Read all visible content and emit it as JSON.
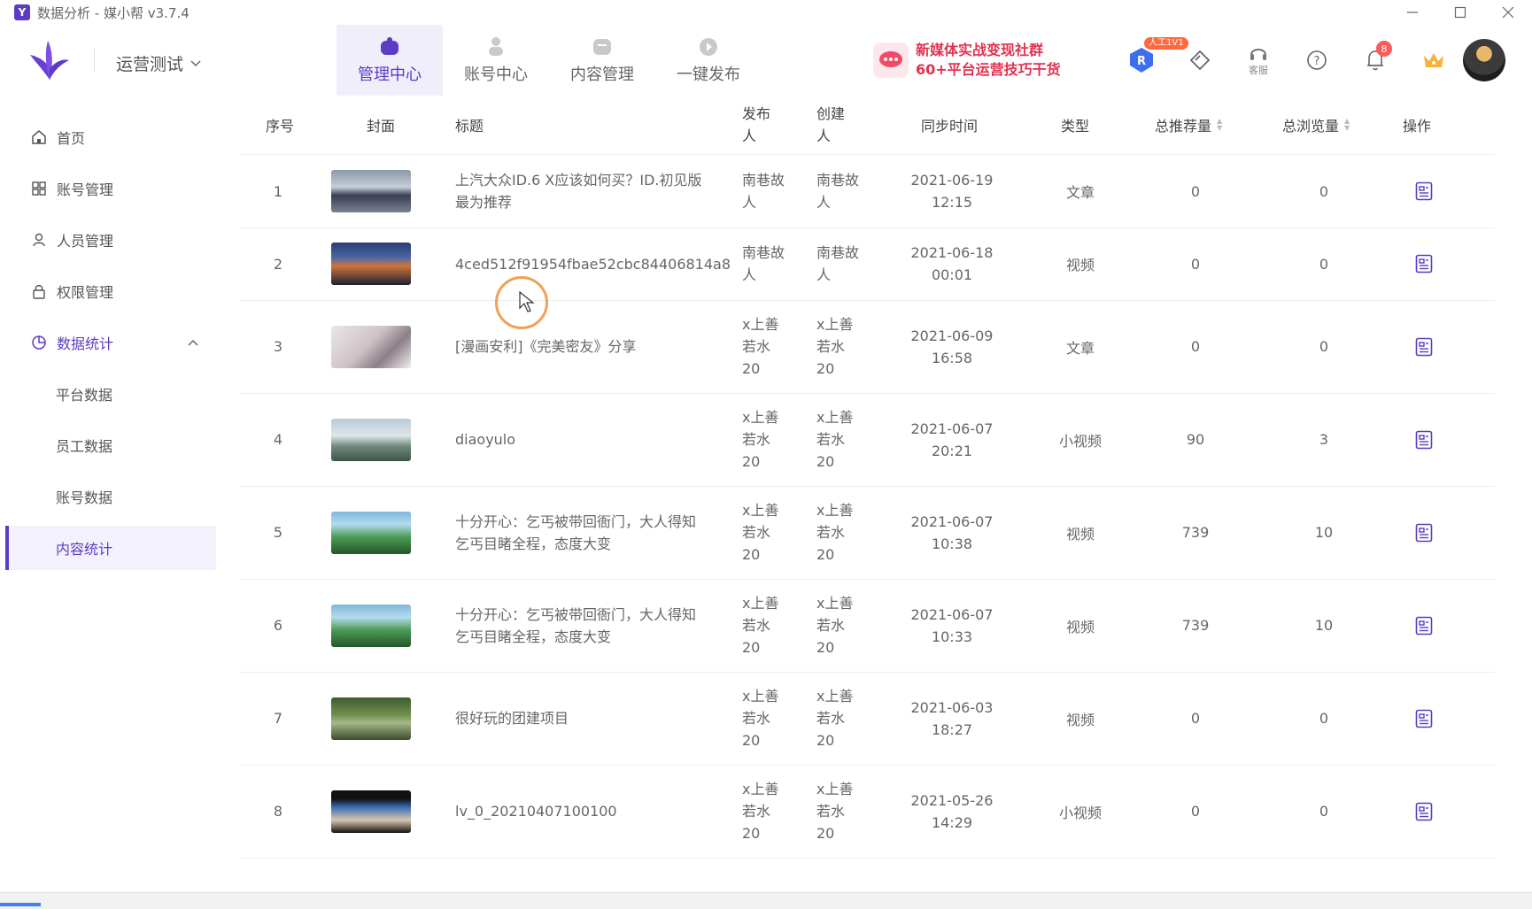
{
  "window": {
    "title": "数据分析 - 媒小帮 v3.7.4",
    "app_icon": "Y",
    "controls": [
      "minimize-icon",
      "maximize-icon",
      "close-icon"
    ]
  },
  "header": {
    "team_name": "运营测试",
    "nav": [
      {
        "label": "管理中心",
        "icon": "management-center-icon",
        "active": true
      },
      {
        "label": "账号中心",
        "icon": "account-center-icon",
        "active": false
      },
      {
        "label": "内容管理",
        "icon": "content-management-icon",
        "active": false
      },
      {
        "label": "一键发布",
        "icon": "publish-icon",
        "active": false
      }
    ],
    "banner": {
      "line1": "新媒体实战变现社群",
      "line2": "60+平台运营技巧干货"
    },
    "tag_label": "人工1V1",
    "service_label": "客服",
    "notification_count": "8",
    "accent_color": "#5b3cc4"
  },
  "sidebar": {
    "items": [
      {
        "label": "首页",
        "icon": "home-icon"
      },
      {
        "label": "账号管理",
        "icon": "grid-icon"
      },
      {
        "label": "人员管理",
        "icon": "user-icon"
      },
      {
        "label": "权限管理",
        "icon": "lock-icon"
      },
      {
        "label": "数据统计",
        "icon": "chart-icon",
        "expanded": true
      }
    ],
    "sub_items": [
      {
        "label": "平台数据"
      },
      {
        "label": "员工数据"
      },
      {
        "label": "账号数据"
      },
      {
        "label": "内容统计",
        "active": true
      }
    ]
  },
  "table": {
    "columns": {
      "index": "序号",
      "cover": "封面",
      "title": "标题",
      "publisher": "发布人",
      "creator": "创建人",
      "sync_time": "同步时间",
      "type": "类型",
      "recommend": "总推荐量",
      "views": "总浏览量",
      "action": "操作"
    },
    "rows": [
      {
        "index": "1",
        "title": "上汽大众ID.6 X应该如何买？ID.初见版最为推荐",
        "publisher": "南巷故人",
        "creator": "南巷故人",
        "date": "2021-06-19",
        "time": "12:15",
        "type": "文章",
        "recommend": "0",
        "views": "0"
      },
      {
        "index": "2",
        "title": "4ced512f91954fbae52cbc84406814a8",
        "publisher": "南巷故人",
        "creator": "南巷故人",
        "date": "2021-06-18",
        "time": "00:01",
        "type": "视频",
        "recommend": "0",
        "views": "0"
      },
      {
        "index": "3",
        "title": "[漫画安利]《完美密友》分享",
        "publisher": "x上善若水20",
        "creator": "x上善若水20",
        "date": "2021-06-09",
        "time": "16:58",
        "type": "文章",
        "recommend": "0",
        "views": "0"
      },
      {
        "index": "4",
        "title": "diaoyulo",
        "publisher": "x上善若水20",
        "creator": "x上善若水20",
        "date": "2021-06-07",
        "time": "20:21",
        "type": "小视频",
        "recommend": "90",
        "views": "3"
      },
      {
        "index": "5",
        "title": "十分开心：乞丐被带回衙门，大人得知乞丐目睹全程，态度大变",
        "publisher": "x上善若水20",
        "creator": "x上善若水20",
        "date": "2021-06-07",
        "time": "10:38",
        "type": "视频",
        "recommend": "739",
        "views": "10"
      },
      {
        "index": "6",
        "title": "十分开心：乞丐被带回衙门，大人得知乞丐目睹全程，态度大变",
        "publisher": "x上善若水20",
        "creator": "x上善若水20",
        "date": "2021-06-07",
        "time": "10:33",
        "type": "视频",
        "recommend": "739",
        "views": "10"
      },
      {
        "index": "7",
        "title": "很好玩的团建项目",
        "publisher": "x上善若水20",
        "creator": "x上善若水20",
        "date": "2021-06-03",
        "time": "18:27",
        "type": "视频",
        "recommend": "0",
        "views": "0"
      },
      {
        "index": "8",
        "title": "lv_0_20210407100100",
        "publisher": "x上善若水20",
        "creator": "x上善若水20",
        "date": "2021-05-26",
        "time": "14:29",
        "type": "小视频",
        "recommend": "0",
        "views": "0"
      }
    ]
  }
}
